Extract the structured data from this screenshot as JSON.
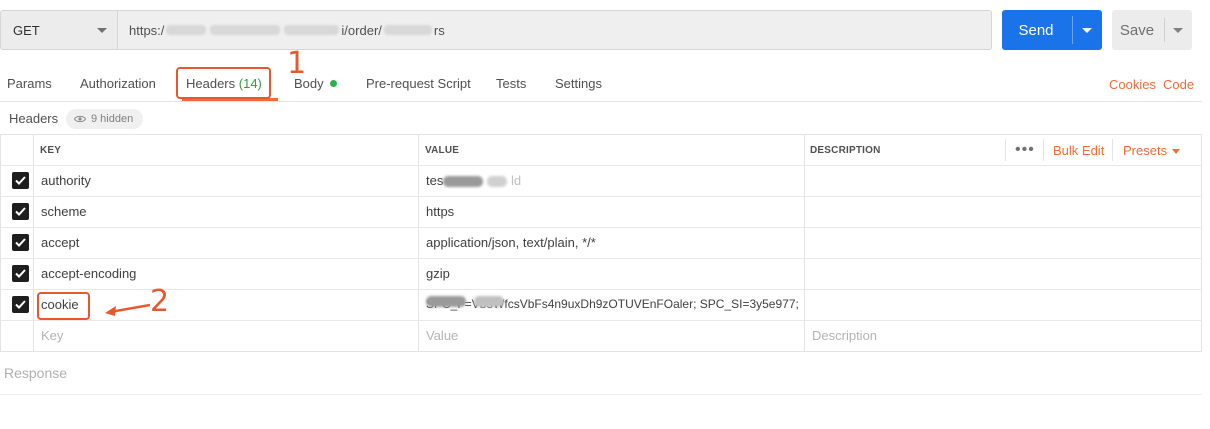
{
  "request": {
    "method": "GET",
    "url_prefix": "https:/",
    "url_mid": "i/order/",
    "url_suffix": "rs",
    "send_label": "Send",
    "save_label": "Save"
  },
  "tabs": [
    {
      "label": "Params"
    },
    {
      "label": "Authorization"
    },
    {
      "label": "Headers",
      "count": "(14)",
      "active": true
    },
    {
      "label": "Body"
    },
    {
      "label": "Pre-request Script"
    },
    {
      "label": "Tests"
    },
    {
      "label": "Settings"
    }
  ],
  "right_links": {
    "cookies": "Cookies",
    "code": "Code"
  },
  "headers_bar": {
    "title": "Headers",
    "hidden": "9 hidden"
  },
  "table": {
    "columns": {
      "key": "KEY",
      "value": "VALUE",
      "description": "DESCRIPTION"
    },
    "more": "•••",
    "bulk_edit": "Bulk Edit",
    "presets": "Presets",
    "rows": [
      {
        "key": "authority",
        "value_visible": "tes",
        "value_tail": "ld",
        "checked": true
      },
      {
        "key": "scheme",
        "value": "https",
        "checked": true
      },
      {
        "key": "accept",
        "value": "application/json, text/plain, */*",
        "checked": true
      },
      {
        "key": "accept-encoding",
        "value": "gzip",
        "checked": true
      },
      {
        "key": "cookie",
        "value": "SPC_F=Vb3WfcsVbFs4n9uxDh9zOTUVEnFOaler; SPC_SI=3y5e977;...",
        "checked": true
      }
    ],
    "placeholder": {
      "key": "Key",
      "value": "Value",
      "description": "Description"
    }
  },
  "response_label": "Response",
  "annotations": {
    "one": "1",
    "two": "2"
  },
  "colors": {
    "accent": "#f26b3a",
    "send": "#1a73e8",
    "annotation": "#e8582c",
    "body_dot": "#2ab24a"
  }
}
